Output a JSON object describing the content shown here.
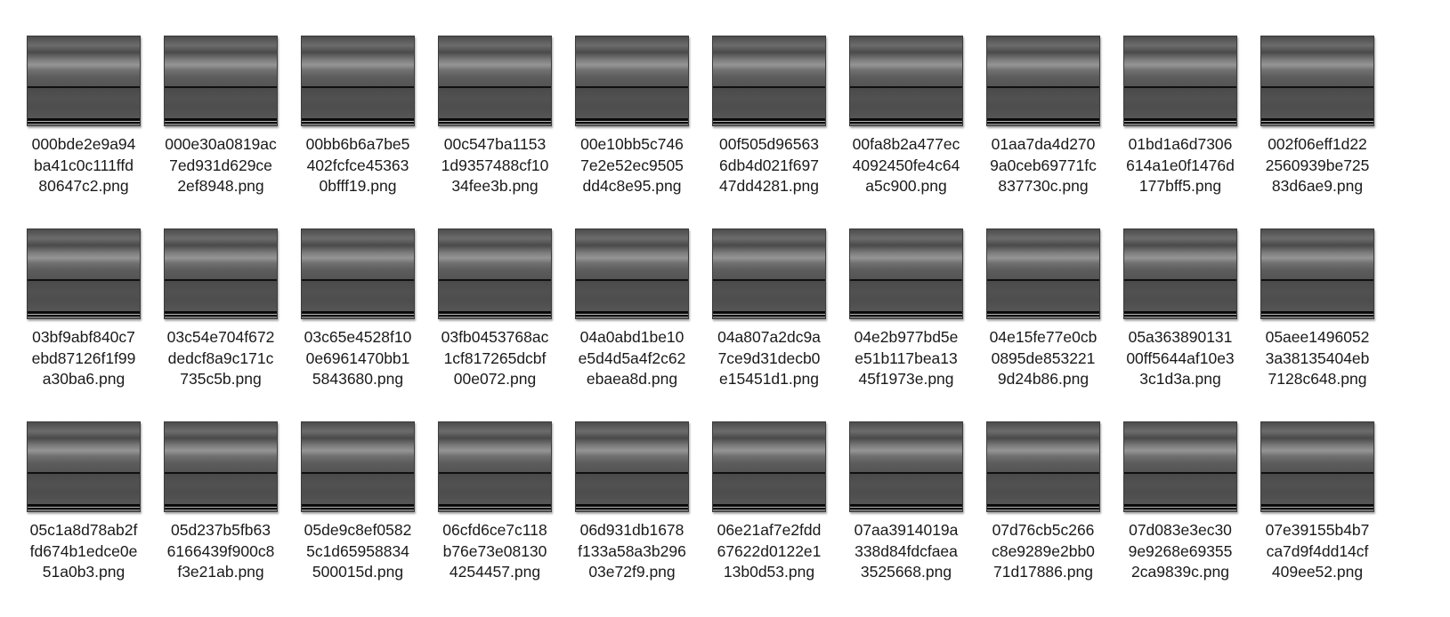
{
  "files": [
    {
      "name_lines": [
        "000bde2e9a94",
        "ba41c0c111ffd",
        "80647c2.png"
      ]
    },
    {
      "name_lines": [
        "000e30a0819ac",
        "7ed931d629ce",
        "2ef8948.png"
      ]
    },
    {
      "name_lines": [
        "00bb6b6a7be5",
        "402fcfce45363",
        "0bfff19.png"
      ]
    },
    {
      "name_lines": [
        "00c547ba1153",
        "1d9357488cf10",
        "34fee3b.png"
      ]
    },
    {
      "name_lines": [
        "00e10bb5c746",
        "7e2e52ec9505",
        "dd4c8e95.png"
      ]
    },
    {
      "name_lines": [
        "00f505d96563",
        "6db4d021f697",
        "47dd4281.png"
      ]
    },
    {
      "name_lines": [
        "00fa8b2a477ec",
        "4092450fe4c64",
        "a5c900.png"
      ]
    },
    {
      "name_lines": [
        "01aa7da4d270",
        "9a0ceb69771fc",
        "837730c.png"
      ]
    },
    {
      "name_lines": [
        "01bd1a6d7306",
        "614a1e0f1476d",
        "177bff5.png"
      ]
    },
    {
      "name_lines": [
        "002f06eff1d22",
        "2560939be725",
        "83d6ae9.png"
      ]
    },
    {
      "name_lines": [
        "03bf9abf840c7",
        "ebd87126f1f99",
        "a30ba6.png"
      ]
    },
    {
      "name_lines": [
        "03c54e704f672",
        "dedcf8a9c171c",
        "735c5b.png"
      ]
    },
    {
      "name_lines": [
        "03c65e4528f10",
        "0e6961470bb1",
        "5843680.png"
      ]
    },
    {
      "name_lines": [
        "03fb0453768ac",
        "1cf817265dcbf",
        "00e072.png"
      ]
    },
    {
      "name_lines": [
        "04a0abd1be10",
        "e5d4d5a4f2c62",
        "ebaea8d.png"
      ]
    },
    {
      "name_lines": [
        "04a807a2dc9a",
        "7ce9d31decb0",
        "e15451d1.png"
      ]
    },
    {
      "name_lines": [
        "04e2b977bd5e",
        "e51b117bea13",
        "45f1973e.png"
      ]
    },
    {
      "name_lines": [
        "04e15fe77e0cb",
        "0895de853221",
        "9d24b86.png"
      ]
    },
    {
      "name_lines": [
        "05a363890131",
        "00ff5644af10e3",
        "3c1d3a.png"
      ]
    },
    {
      "name_lines": [
        "05aee1496052",
        "3a38135404eb",
        "7128c648.png"
      ]
    },
    {
      "name_lines": [
        "05c1a8d78ab2f",
        "fd674b1edce0e",
        "51a0b3.png"
      ]
    },
    {
      "name_lines": [
        "05d237b5fb63",
        "6166439f900c8",
        "f3e21ab.png"
      ]
    },
    {
      "name_lines": [
        "05de9c8ef0582",
        "5c1d65958834",
        "500015d.png"
      ]
    },
    {
      "name_lines": [
        "06cfd6ce7c118",
        "b76e73e08130",
        "4254457.png"
      ]
    },
    {
      "name_lines": [
        "06d931db1678",
        "f133a58a3b296",
        "03e72f9.png"
      ]
    },
    {
      "name_lines": [
        "06e21af7e2fdd",
        "67622d0122e1",
        "13b0d53.png"
      ]
    },
    {
      "name_lines": [
        "07aa3914019a",
        "338d84fdcfaea",
        "3525668.png"
      ]
    },
    {
      "name_lines": [
        "07d76cb5c266",
        "c8e9289e2bb0",
        "71d17886.png"
      ]
    },
    {
      "name_lines": [
        "07d083e3ec30",
        "9e9268e69355",
        "2ca9839c.png"
      ]
    },
    {
      "name_lines": [
        "07e39155b4b7",
        "ca7d9f4dd14cf",
        "409ee52.png"
      ]
    }
  ]
}
